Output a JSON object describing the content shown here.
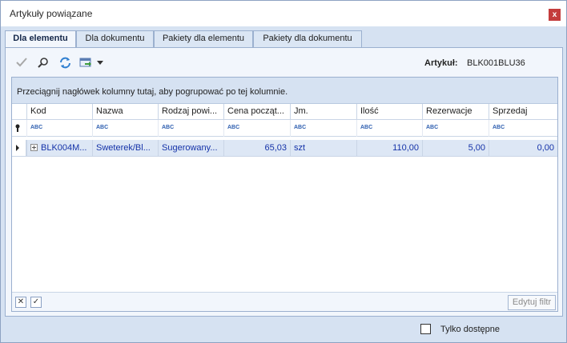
{
  "window": {
    "title": "Artykuły powiązane",
    "close_glyph": "x"
  },
  "tabs": [
    {
      "label": "Dla elementu",
      "active": true
    },
    {
      "label": "Dla dokumentu",
      "active": false
    },
    {
      "label": "Pakiety dla elementu",
      "active": false
    },
    {
      "label": "Pakiety dla dokumentu",
      "active": false
    }
  ],
  "toolbar": {
    "icons": [
      "checkmark-icon",
      "search-icon",
      "refresh-icon",
      "export-icon",
      "dropdown-arrow-icon"
    ],
    "artykul_label": "Artykuł:",
    "artykul_value": "BLK001BLU36"
  },
  "grid": {
    "group_hint": "Przeciągnij nagłówek kolumny tutaj, aby pogrupować po tej kolumnie.",
    "columns": [
      "Kod",
      "Nazwa",
      "Rodzaj powi...",
      "Cena począt...",
      "Jm.",
      "Ilość",
      "Rezerwacje",
      "Sprzedaj"
    ],
    "filter_glyph": "ABC",
    "rows": [
      [
        "BLK004M...",
        "Sweterek/Bl...",
        "Sugerowany...",
        "65,03",
        "szt",
        "110,00",
        "5,00",
        "0,00"
      ]
    ],
    "edit_filter_label": "Edytuj filtr"
  },
  "footer": {
    "only_available_label": "Tylko dostępne",
    "only_available_checked": false
  },
  "colors": {
    "accent": "#1432a8",
    "panel_bg": "#d6e2f2",
    "close": "#c43c3c"
  }
}
